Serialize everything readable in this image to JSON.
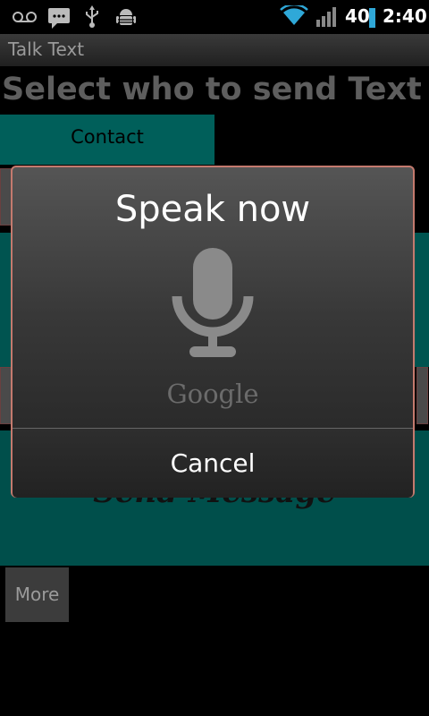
{
  "status_bar": {
    "battery_level": "40",
    "time": "2:40",
    "icons": [
      "voicemail-icon",
      "sms-icon",
      "usb-icon",
      "android-debug-icon",
      "wifi-icon",
      "signal-icon",
      "battery-icon"
    ]
  },
  "app": {
    "title": "Talk Text"
  },
  "main": {
    "heading": "Select who to send Text to",
    "tab_contact": "Contact",
    "send_label": "Send Message",
    "more_label": "More"
  },
  "dialog": {
    "title": "Speak now",
    "brand": "Google",
    "cancel_label": "Cancel",
    "icon": "microphone-icon"
  },
  "colors": {
    "teal": "#005450",
    "dialog_border": "#c47a6e",
    "wifi": "#2fa8d8"
  }
}
